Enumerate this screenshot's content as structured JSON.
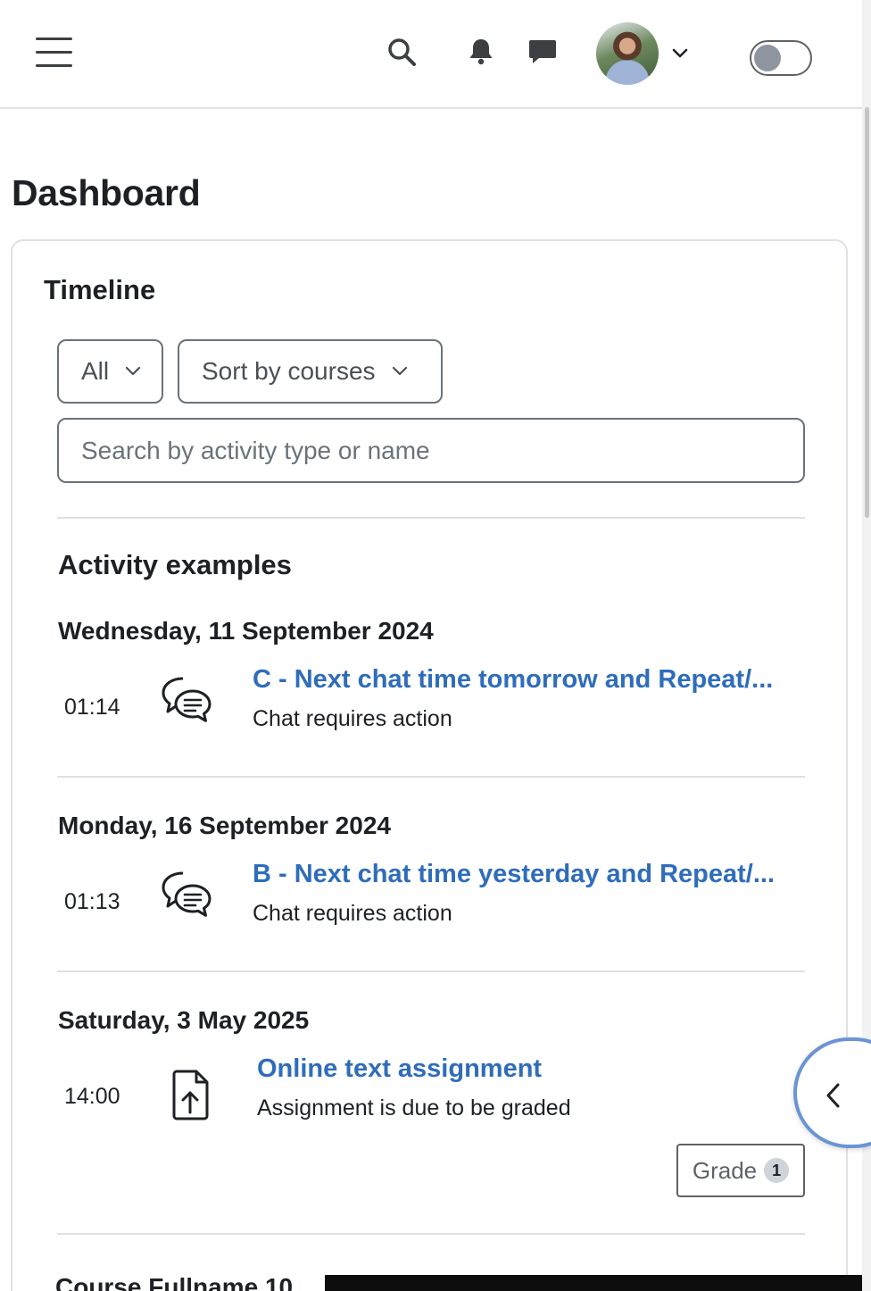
{
  "navbar": {
    "menu_icon": "hamburger-icon",
    "search_icon": "search-icon",
    "notifications_icon": "bell-icon",
    "messages_icon": "chat-bubble-icon",
    "user_menu_caret": "chevron-down-icon",
    "edit_mode_toggle": "off"
  },
  "page": {
    "title": "Dashboard"
  },
  "timeline": {
    "title": "Timeline",
    "filter_label": "All",
    "sort_label": "Sort by courses",
    "search_placeholder": "Search by activity type or name",
    "group_title": "Activity examples",
    "days": [
      {
        "date": "Wednesday, 11 September 2024",
        "events": [
          {
            "time": "01:14",
            "icon": "chat-icon",
            "title": "C - Next chat time tomorrow and Repeat/...",
            "subtitle": "Chat requires action"
          }
        ]
      },
      {
        "date": "Monday, 16 September 2024",
        "events": [
          {
            "time": "01:13",
            "icon": "chat-icon",
            "title": "B - Next chat time yesterday and Repeat/...",
            "subtitle": "Chat requires action"
          }
        ]
      },
      {
        "date": "Saturday, 3 May 2025",
        "events": [
          {
            "time": "14:00",
            "icon": "assignment-upload-icon",
            "title": "Online text assignment",
            "subtitle": "Assignment is due to be graded",
            "action_label": "Grade",
            "action_count": "1"
          }
        ]
      }
    ],
    "next_group_title": "Course Fullname 10"
  },
  "colors": {
    "link": "#2f6dba",
    "drawer_ring": "#6a94d4",
    "border": "#dee2e6"
  }
}
